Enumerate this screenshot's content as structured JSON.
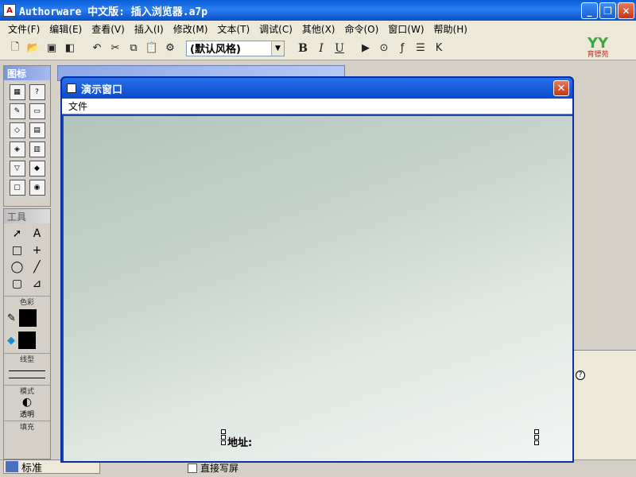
{
  "window": {
    "title": "Authorware 中文版: 插入浏览器.a7p",
    "minimize": "_",
    "restore": "❐",
    "close": "✕"
  },
  "menu": [
    "文件(F)",
    "编辑(E)",
    "查看(V)",
    "插入(I)",
    "修改(M)",
    "文本(T)",
    "调试(C)",
    "其他(X)",
    "命令(O)",
    "窗口(W)",
    "帮助(H)"
  ],
  "toolbar": {
    "style_value": "(默认风格)",
    "bold": "B",
    "italic": "I",
    "underline": "U"
  },
  "logo": {
    "mark": "YY",
    "text": "育镖苑"
  },
  "icons_palette": {
    "title": "图标"
  },
  "tools_palette": {
    "title": "工具",
    "color_label": "色彩",
    "line_label": "线型",
    "mode_label": "模式",
    "mode_value": "透明",
    "fill_label": "填充"
  },
  "presentation": {
    "title": "演示窗口",
    "menu_file": "文件",
    "close": "✕",
    "address_label": "地址:"
  },
  "status": {
    "mode_text": "标准",
    "direct_screen": "直接写屏"
  },
  "help_icon": "?"
}
